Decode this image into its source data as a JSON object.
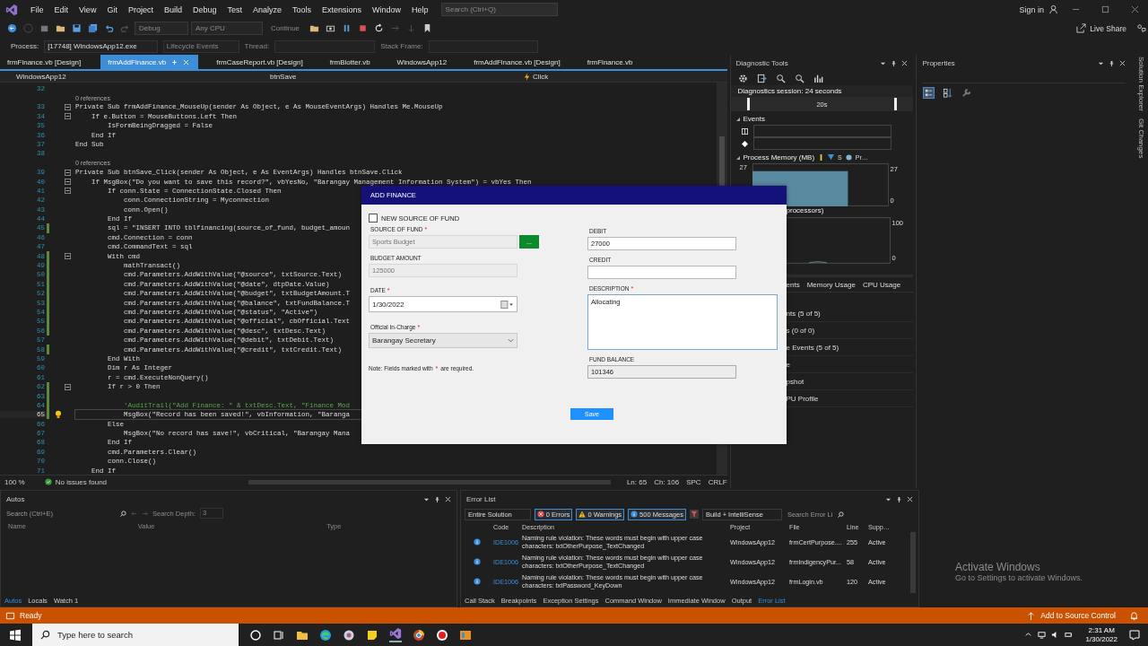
{
  "menu": {
    "items": [
      "File",
      "Edit",
      "View",
      "Git",
      "Project",
      "Build",
      "Debug",
      "Test",
      "Analyze",
      "Tools",
      "Extensions",
      "Window",
      "Help"
    ],
    "search": {
      "placeholder": "Search (Ctrl+Q)"
    },
    "sign_in": "Sign in"
  },
  "toolbar": {
    "configuration": {
      "value": "Debug",
      "disabled": true
    },
    "platform": {
      "value": "Any CPU",
      "disabled": true
    },
    "continue": {
      "label": "Continue",
      "disabled": true
    },
    "live_share": "Live Share"
  },
  "process_bar": {
    "process_label": "Process:",
    "process": "[17748] WindowsApp12.exe",
    "lifecycle": "Lifecycle Events",
    "thread_label": "Thread:",
    "stack_frame_label": "Stack Frame:"
  },
  "editor_tabs": [
    {
      "label": "frmFinance.vb [Design]",
      "selected": false
    },
    {
      "label": "frmAddFinance.vb",
      "selected": true
    },
    {
      "label": "frmCaseReport.vb [Design]",
      "selected": false
    },
    {
      "label": "frmBlotter.vb",
      "selected": false
    },
    {
      "label": "WindowsApp12",
      "selected": false
    },
    {
      "label": "frmAddFinance.vb [Design]",
      "selected": false
    },
    {
      "label": "frmFinance.vb",
      "selected": false
    }
  ],
  "nav_bar": {
    "project": "WindowsApp12",
    "object": "btnSave",
    "event": "Click"
  },
  "code_lines": [
    {
      "no": "32",
      "kind": "code",
      "changed": false,
      "foldable": false,
      "current": false
    },
    {
      "kind": "lens",
      "text": "0 references",
      "changed": false,
      "foldable": false,
      "current": false
    },
    {
      "no": "33",
      "kind": "code",
      "text": "Private Sub frmAddFinance_MouseUp(sender As Object, e As MouseEventArgs) Handles Me.MouseUp",
      "changed": false,
      "foldable": true,
      "current": false
    },
    {
      "no": "34",
      "kind": "code",
      "text": "    If e.Button = MouseButtons.Left Then",
      "changed": false,
      "foldable": true,
      "current": false
    },
    {
      "no": "35",
      "kind": "code",
      "text": "        IsFormBeingDragged = False",
      "changed": false,
      "foldable": false,
      "current": false
    },
    {
      "no": "36",
      "kind": "code",
      "text": "    End If",
      "changed": false,
      "foldable": false,
      "current": false
    },
    {
      "no": "37",
      "kind": "code",
      "text": "End Sub",
      "changed": false,
      "foldable": false,
      "current": false
    },
    {
      "no": "38",
      "kind": "code",
      "changed": false,
      "foldable": false,
      "current": false
    },
    {
      "kind": "lens",
      "text": "0 references",
      "changed": false,
      "foldable": false,
      "current": false
    },
    {
      "no": "39",
      "kind": "code",
      "text": "Private Sub btnSave_Click(sender As Object, e As EventArgs) Handles btnSave.Click",
      "changed": false,
      "foldable": true,
      "current": false
    },
    {
      "no": "40",
      "kind": "code",
      "text": "    If MsgBox(\"Do you want to save this record?\", vbYesNo, \"Barangay Management Information System\") = vbYes Then",
      "changed": false,
      "foldable": true,
      "current": false
    },
    {
      "no": "41",
      "kind": "code",
      "text": "        If conn.State = ConnectionState.Closed Then",
      "changed": false,
      "foldable": true,
      "current": false
    },
    {
      "no": "42",
      "kind": "code",
      "text": "            conn.ConnectionString = Myconnection",
      "changed": false,
      "foldable": false,
      "current": false
    },
    {
      "no": "43",
      "kind": "code",
      "text": "            conn.Open()",
      "changed": false,
      "foldable": false,
      "current": false
    },
    {
      "no": "44",
      "kind": "code",
      "text": "        End If",
      "changed": false,
      "foldable": false,
      "current": false
    },
    {
      "no": "45",
      "kind": "code",
      "text": "        sql = \"INSERT INTO tblfinancing(source_of_fund, budget_amoun",
      "changed": true,
      "foldable": false,
      "current": false
    },
    {
      "no": "46",
      "kind": "code",
      "text": "        cmd.Connection = conn",
      "changed": false,
      "foldable": false,
      "current": false
    },
    {
      "no": "47",
      "kind": "code",
      "text": "        cmd.CommandText = sql",
      "changed": false,
      "foldable": false,
      "current": false
    },
    {
      "no": "48",
      "kind": "code",
      "text": "        With cmd",
      "changed": true,
      "foldable": true,
      "current": false
    },
    {
      "no": "49",
      "kind": "code",
      "text": "            mathTransact()",
      "changed": true,
      "foldable": false,
      "current": false
    },
    {
      "no": "50",
      "kind": "code",
      "text": "            cmd.Parameters.AddWithValue(\"@source\", txtSource.Text)",
      "changed": true,
      "foldable": false,
      "current": false
    },
    {
      "no": "51",
      "kind": "code",
      "text": "            cmd.Parameters.AddWithValue(\"@date\", dtpDate.Value)",
      "changed": true,
      "foldable": false,
      "current": false
    },
    {
      "no": "52",
      "kind": "code",
      "text": "            cmd.Parameters.AddWithValue(\"@budget\", txtBudgetAmount.T",
      "changed": true,
      "foldable": false,
      "current": false
    },
    {
      "no": "53",
      "kind": "code",
      "text": "            cmd.Parameters.AddWithValue(\"@balance\", txtFundBalance.T",
      "changed": true,
      "foldable": false,
      "current": false
    },
    {
      "no": "54",
      "kind": "code",
      "text": "            cmd.Parameters.AddWithValue(\"@status\", \"Active\")",
      "changed": true,
      "foldable": false,
      "current": false
    },
    {
      "no": "55",
      "kind": "code",
      "text": "            cmd.Parameters.AddWithValue(\"@official\", cbOfficial.Text",
      "changed": true,
      "foldable": false,
      "current": false
    },
    {
      "no": "56",
      "kind": "code",
      "text": "            cmd.Parameters.AddWithValue(\"@desc\", txtDesc.Text)",
      "changed": true,
      "foldable": false,
      "current": false
    },
    {
      "no": "57",
      "kind": "code",
      "text": "            cmd.Parameters.AddWithValue(\"@debit\", txtDebit.Text)",
      "changed": false,
      "foldable": false,
      "current": false
    },
    {
      "no": "58",
      "kind": "code",
      "text": "            cmd.Parameters.AddWithValue(\"@credit\", txtCredit.Text)",
      "changed": true,
      "foldable": false,
      "current": false
    },
    {
      "no": "59",
      "kind": "code",
      "text": "        End With",
      "changed": false,
      "foldable": false,
      "current": false
    },
    {
      "no": "60",
      "kind": "code",
      "text": "        Dim r As Integer",
      "changed": false,
      "foldable": false,
      "current": false
    },
    {
      "no": "61",
      "kind": "code",
      "text": "        r = cmd.ExecuteNonQuery()",
      "changed": false,
      "foldable": false,
      "current": false
    },
    {
      "no": "62",
      "kind": "code",
      "text": "        If r > 0 Then",
      "changed": true,
      "foldable": true,
      "current": false
    },
    {
      "no": "63",
      "kind": "code",
      "changed": true,
      "foldable": false,
      "current": false
    },
    {
      "no": "64",
      "kind": "comment",
      "text": "            'AuditTrail(\"Add Finance: \" & txtDesc.Text, \"Finance Mod",
      "changed": true,
      "foldable": false,
      "current": false
    },
    {
      "no": "65",
      "kind": "code",
      "text": "            MsgBox(\"Record has been saved!\", vbInformation, \"Baranga",
      "changed": true,
      "foldable": false,
      "current": true
    },
    {
      "no": "66",
      "kind": "code",
      "text": "        Else",
      "changed": false,
      "foldable": false,
      "current": false
    },
    {
      "no": "67",
      "kind": "code",
      "text": "            MsgBox(\"No record has save!\", vbCritical, \"Barangay Mana",
      "changed": false,
      "foldable": false,
      "current": false
    },
    {
      "no": "68",
      "kind": "code",
      "text": "        End If",
      "changed": false,
      "foldable": false,
      "current": false
    },
    {
      "no": "69",
      "kind": "code",
      "text": "        cmd.Parameters.Clear()",
      "changed": false,
      "foldable": false,
      "current": false
    },
    {
      "no": "70",
      "kind": "code",
      "text": "        conn.Close()",
      "changed": false,
      "foldable": false,
      "current": false
    },
    {
      "no": "71",
      "kind": "code",
      "text": "    End If",
      "changed": false,
      "foldable": false,
      "current": false
    }
  ],
  "editor_status": {
    "zoom": "100 %",
    "issues": "No issues found",
    "line": "Ln: 65",
    "column": "Ch: 106",
    "spacing": "SPC",
    "line_ending": "CRLF"
  },
  "diagnostic_tools": {
    "title": "Diagnostic Tools",
    "session": "Diagnostics session: 24 seconds",
    "timeline_tick": "20s",
    "events_header": "Events",
    "memory_header": "Process Memory (MB)",
    "memory_legend": [
      "S",
      "Pr…"
    ],
    "memory_left_tick": "27",
    "memory_right_ticks": [
      "27",
      "0"
    ],
    "cpu_header": "processors)",
    "cpu_ticks": [
      "100",
      "0"
    ],
    "tabs": [
      "ents",
      "Memory Usage",
      "CPU Usage"
    ],
    "rows": [
      "nts (5 of 5)",
      "s (0 of 0)",
      "e Events (5 of 5)",
      "e",
      "pshot",
      "PU Profile"
    ]
  },
  "properties": {
    "title": "Properties"
  },
  "side_tabs": [
    "Solution Explorer",
    "Git Changes"
  ],
  "autos": {
    "title": "Autos",
    "search_placeholder": "Search (Ctrl+E)",
    "depth_label": "Search Depth:",
    "depth": "3",
    "columns": [
      "Name",
      "Value",
      "Type"
    ]
  },
  "autos_tabs": [
    {
      "label": "Autos",
      "selected": true
    },
    {
      "label": "Locals",
      "selected": false
    },
    {
      "label": "Watch 1",
      "selected": false
    }
  ],
  "error_list": {
    "title": "Error List",
    "scope": "Entire Solution",
    "filters": [
      {
        "label": "0 Errors",
        "kind": "error",
        "selected": true
      },
      {
        "label": "0 Warnings",
        "kind": "warning",
        "selected": true
      },
      {
        "label": "500 Messages",
        "kind": "message",
        "selected": true
      }
    ],
    "source": "Build + IntelliSense",
    "search_placeholder": "Search Error Li",
    "columns": [
      "Code",
      "Description",
      "Project",
      "File",
      "Line",
      "Supp…"
    ],
    "rows": [
      {
        "code": "IDE1006",
        "description": "Naming rule violation: These words must begin with upper case characters: txtOtherPurpose_TextChanged",
        "project": "WindowsApp12",
        "file": "frmCertPurpose....",
        "line": "255",
        "suppression": "Active"
      },
      {
        "code": "IDE1006",
        "description": "Naming rule violation: These words must begin with upper case characters: txtOtherPurpose_TextChanged",
        "project": "WindowsApp12",
        "file": "frmIndigencyPur...",
        "line": "58",
        "suppression": "Active"
      },
      {
        "code": "IDE1006",
        "description": "Naming rule violation: These words must begin with upper case characters: txtPassword_KeyDown",
        "project": "WindowsApp12",
        "file": "frmLogin.vb",
        "line": "120",
        "suppression": "Active"
      }
    ]
  },
  "bottom_tabs": [
    {
      "label": "Call Stack",
      "selected": false
    },
    {
      "label": "Breakpoints",
      "selected": false
    },
    {
      "label": "Exception Settings",
      "selected": false
    },
    {
      "label": "Command Window",
      "selected": false
    },
    {
      "label": "Immediate Window",
      "selected": false
    },
    {
      "label": "Output",
      "selected": false
    },
    {
      "label": "Error List",
      "selected": true
    }
  ],
  "activation": {
    "title": "Activate Windows",
    "hint": "Go to Settings to activate Windows."
  },
  "status_bar": {
    "text": "Ready",
    "source_control": "Add to Source Control"
  },
  "taskbar": {
    "search_placeholder": "Type here to search",
    "time": "2:31 AM",
    "date": "1/30/2022"
  },
  "dialog": {
    "title": "ADD FINANCE",
    "new_source": {
      "label": "NEW SOURCE OF FUND",
      "checked": false
    },
    "left_fields": [
      {
        "label": "SOURCE OF FUND",
        "mark": "*",
        "value": "Sports Budget",
        "kind": "browse",
        "browse": "...",
        "disabled": true,
        "focused": false
      },
      {
        "label": "BUDGET AMOUNT",
        "value": "125000",
        "kind": "text",
        "disabled": true,
        "focused": false
      },
      {
        "label": "DATE",
        "mark": "*",
        "value": "1/30/2022",
        "kind": "date",
        "disabled": false,
        "focused": false
      },
      {
        "label": "Official In-Charge",
        "mark": "*",
        "value": "Barangay Secretary",
        "kind": "select",
        "disabled": false,
        "focused": false
      }
    ],
    "right_fields": [
      {
        "label": "DEBIT",
        "value": "27000",
        "kind": "text",
        "disabled": false,
        "focused": false
      },
      {
        "label": "CREDIT",
        "kind": "text",
        "disabled": false,
        "focused": false
      },
      {
        "label": "DESCRIPTION",
        "mark": "*",
        "value": "Allocating",
        "kind": "textarea",
        "disabled": false,
        "focused": true
      },
      {
        "label": "FUND BALANCE",
        "value": "101346",
        "kind": "text",
        "disabled": true,
        "focused": false
      }
    ],
    "note": {
      "before": "Note: Fields marked with",
      "mark": "*",
      "after": "are required."
    },
    "save": "Save"
  }
}
